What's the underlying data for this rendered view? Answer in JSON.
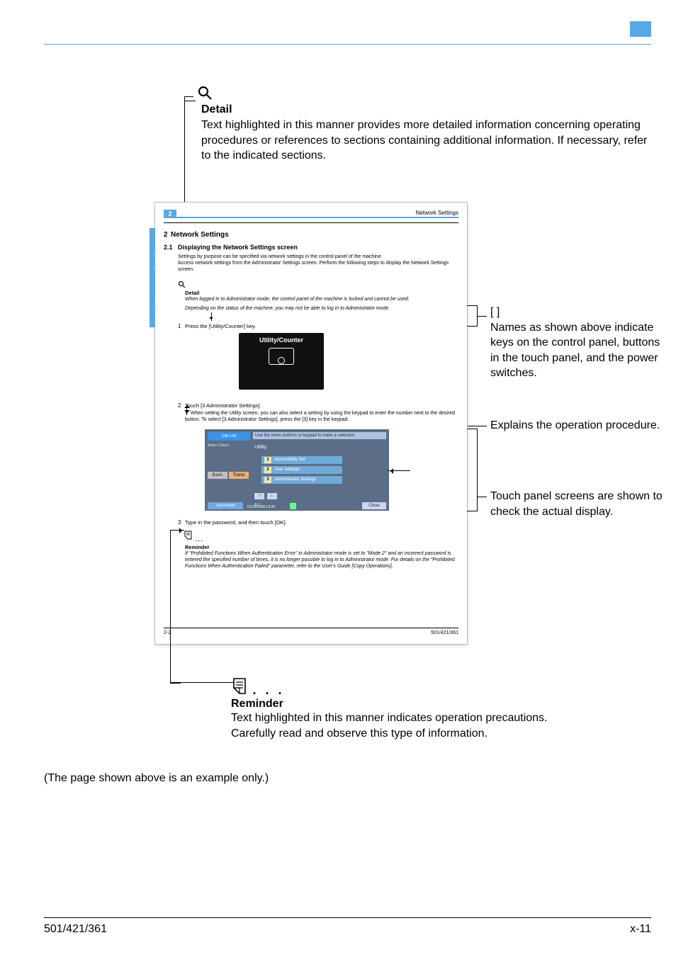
{
  "footer": {
    "left": "501/421/361",
    "right": "x-11"
  },
  "detail": {
    "title": "Detail",
    "body": "Text highlighted in this manner provides more detailed information concerning operating procedures or references to sections containing additional information. If necessary, refer to the indicated sections."
  },
  "mini": {
    "chapter_num_top": "2",
    "page_header_right": "Network Settings",
    "h1_num": "2",
    "h1": "Network Settings",
    "h2_num": "2.1",
    "h2": "Displaying the Network Settings screen",
    "para1_line1": "Settings by purpose can be specified via network settings in the control panel of the machine.",
    "para1_line2": "Access network settings from the Administrator Settings screen. Perform the following steps to display the Network Settings screen.",
    "detail_label": "Detail",
    "detail_line1": "When logged in to Administrator mode, the control panel of the machine is locked and cannot be used.",
    "detail_line2": "Depending on the status of the machine, you may not be able to log in to Administrator mode.",
    "step1_num": "1",
    "step1": "Press the [Utility/Counter] key.",
    "uc_label": "Utility/Counter",
    "step2_num": "2",
    "step2": "Touch [3 Administrator Settings].",
    "step2_sub": "When setting the Utility screen, you can also select a setting by using the keypad to enter the number next to the desired button. To select [3 Administrator Settings], press the [3] key in the keypad.",
    "panel_topbar": "Use the menu buttons or keypad to make a selection.",
    "panel_joblist": "Job List",
    "panel_jobcheck": "Active Check↑",
    "panel_tab_basic": "Basic",
    "panel_tab_trans": "Transi",
    "panel_utility": "Utility",
    "panel_btn1": "Accessibility Set",
    "panel_btn2": "User Settings",
    "panel_btn3": "Administrator Settings",
    "panel_pager_up": "↑",
    "panel_pager_dn": "↓",
    "panel_pagenum": "1/ 1",
    "panel_status": "Job Details",
    "panel_date": "01/25/2008  13:24",
    "panel_close": "Close",
    "step3_num": "3",
    "step3": "Type in the password, and then touch [OK].",
    "rem_label": "Reminder",
    "rem_body": "If \"Prohibited Functions When Authentication Error\" in Administrator mode is set to \"Mode 2\" and an incorrect password is entered the specified number of times, it is no longer possible to log in to Administrator mode. For details on the \"Prohibited Functions When Authentication Failed\" parameter, refer to the User's Guide [Copy Operations].",
    "foot_left": "2-2",
    "foot_right": "501/421/361",
    "side_text_lower": "Network Settings",
    "side_text_upper": "Chapter 2"
  },
  "callouts": {
    "keys_bracket_label": "[  ]",
    "keys": "Names as shown above indicate keys on the control panel, buttons in the touch panel, and the power switches.",
    "procedure": "Explains the operation procedure.",
    "touchpanel": "Touch panel screens are shown to check the actual display."
  },
  "reminder": {
    "dots": ". . .",
    "title": "Reminder",
    "body_line1": "Text highlighted in this manner indicates operation precautions.",
    "body_line2": "Carefully read and observe this type of information."
  },
  "example_note": "(The page shown above is an example only.)"
}
